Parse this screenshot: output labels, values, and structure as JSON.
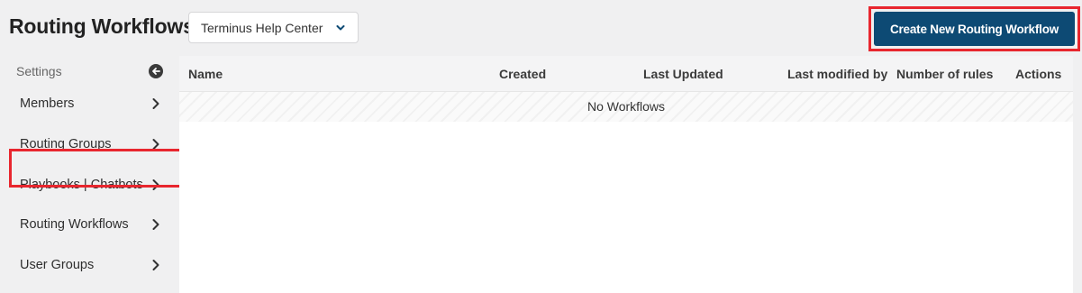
{
  "header": {
    "title": "Routing Workflows",
    "site_selector": {
      "value": "Terminus Help Center",
      "icon": "chevron-down-icon"
    },
    "create_button_label": "Create New Routing Workflow"
  },
  "sidebar": {
    "section_label": "Settings",
    "collapse_icon": "arrow-left-circle-icon",
    "items": [
      {
        "label": "Members"
      },
      {
        "label": "Routing Groups"
      },
      {
        "label": "Playbooks | Chatbots"
      },
      {
        "label": "Routing Workflows",
        "active": true
      },
      {
        "label": "User Groups"
      }
    ]
  },
  "table": {
    "columns": [
      "Name",
      "Created",
      "Last Updated",
      "Last modified by",
      "Number of rules",
      "Actions"
    ],
    "empty_message": "No Workflows"
  },
  "colors": {
    "primary_button": "#0d4a74",
    "highlight_box": "#e8262e",
    "background": "#f0f0f1"
  }
}
